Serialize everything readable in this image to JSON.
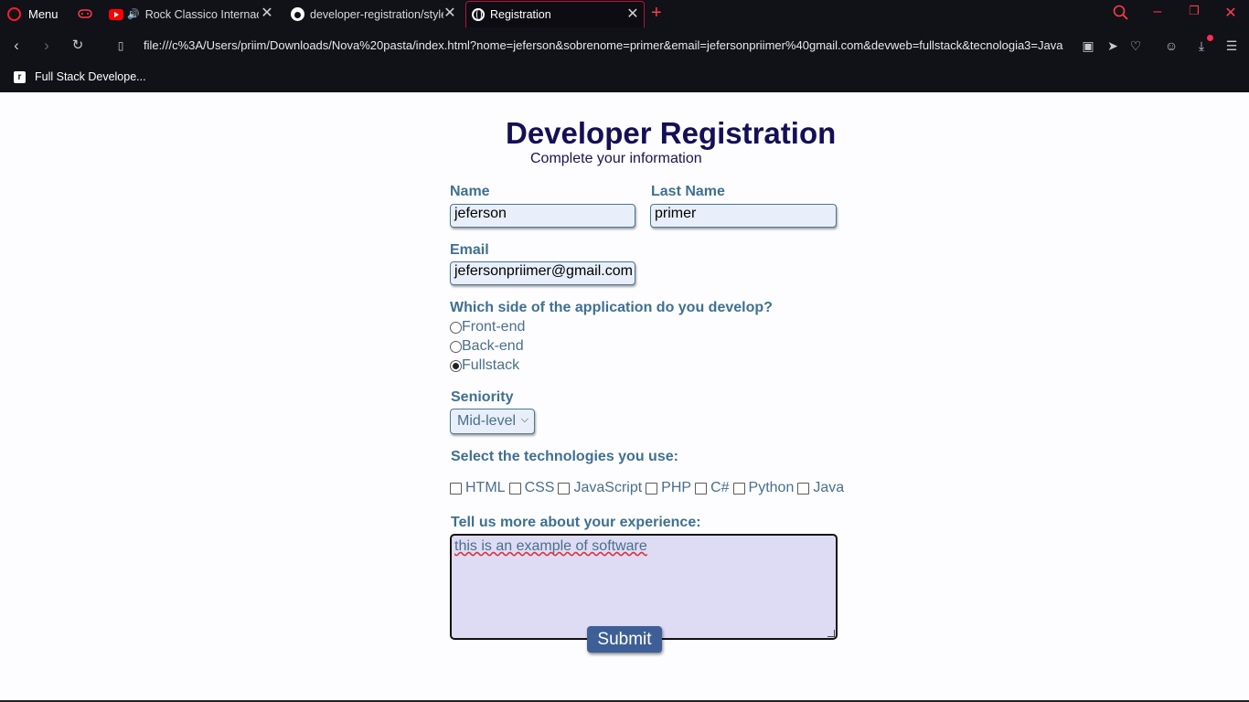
{
  "browser": {
    "menu_label": "Menu",
    "tabs": [
      {
        "title": "Rock Classico Internacional",
        "icon": "youtube-icon",
        "audio": true
      },
      {
        "title": "developer-registration/style.css",
        "icon": "github-icon"
      },
      {
        "title": "Registration",
        "icon": "globe-icon",
        "active": true
      }
    ],
    "url": "file:///c%3A/Users/priim/Downloads/Nova%20pasta/index.html?nome=jeferson&sobrenome=primer&email=jefersonpriimer%40gmail.com&devweb=fullstack&tecnologia3=Java",
    "bookmarks": [
      {
        "label": "Full Stack Develope...",
        "icon": "r"
      }
    ],
    "accent": "#ff1b2d"
  },
  "form": {
    "title": "Developer Registration",
    "subtitle": "Complete your information",
    "name_label": "Name",
    "name_value": "jeferson",
    "lastname_label": "Last Name",
    "lastname_value": "primer",
    "email_label": "Email",
    "email_value": "jefersonpriimer@gmail.com",
    "side_question": "Which side of the application do you develop?",
    "side_options": [
      {
        "label": "Front-end",
        "checked": false
      },
      {
        "label": "Back-end",
        "checked": false
      },
      {
        "label": "Fullstack",
        "checked": true
      }
    ],
    "seniority_label": "Seniority",
    "seniority_value": "Mid-level",
    "tech_label": "Select the technologies you use:",
    "technologies": [
      "HTML",
      "CSS",
      "JavaScript",
      "PHP",
      "C#",
      "Python",
      "Java"
    ],
    "experience_label": "Tell us more about your experience:",
    "experience_value": "this is an example of software",
    "submit_label": "Submit",
    "colors": {
      "title": "#150f55",
      "label": "#3f7090",
      "button": "#3e5f96"
    }
  }
}
